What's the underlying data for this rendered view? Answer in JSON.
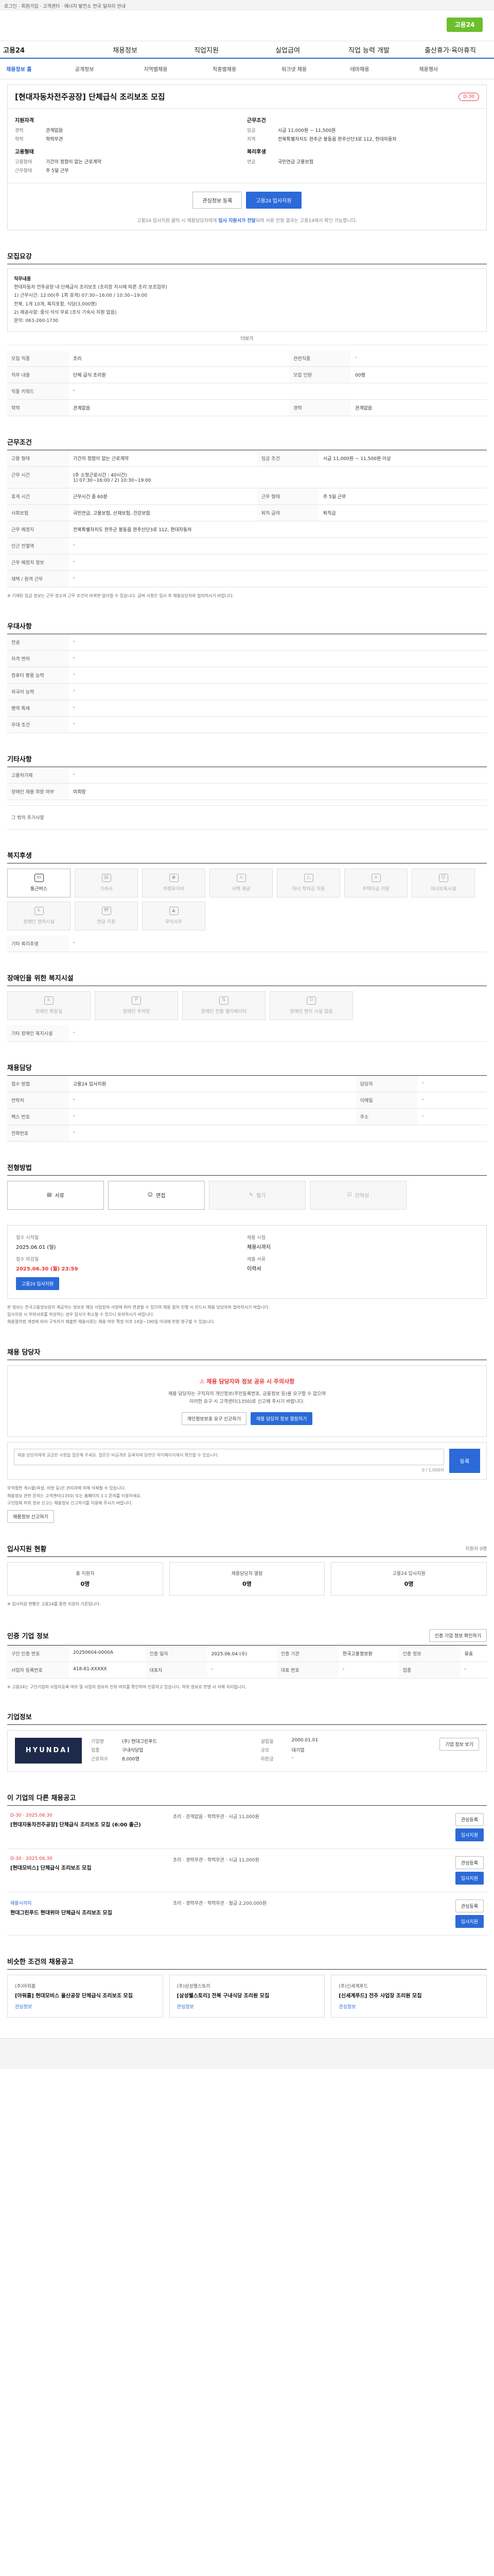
{
  "topbar": {
    "text": "로그인 · 회원가입 · 고객센터 · 에너지 발전소 전국 일자리 안내"
  },
  "header": {
    "logo": "고용24"
  },
  "gnb": [
    "고용24",
    "채용정보",
    "직업지원",
    "실업급여",
    "직업 능력 개발",
    "출산휴가·육아휴직"
  ],
  "subnav": {
    "items": [
      "채용정보 홈",
      "공개정보",
      "지역별채용",
      "직종별채용",
      "워크넷 채용",
      "테마채용",
      "채용행사"
    ],
    "active": 0
  },
  "job": {
    "title": "[현대자동차전주공장] 단체급식 조리보조 모집",
    "dday": "D-30",
    "recruiter": {
      "heading": "지원자격",
      "rows": [
        [
          "경력",
          "관계없음"
        ],
        [
          "학력",
          "학력무관"
        ]
      ]
    },
    "conditions": {
      "heading": "근무조건",
      "rows": [
        [
          "임금",
          "시급 11,000원 ~ 11,500원"
        ],
        [
          "지역",
          "전북특별자치도 완주군 봉동읍 완주산단3로 112, 현대자동차"
        ]
      ]
    },
    "employ": {
      "heading": "고용형태",
      "rows": [
        [
          "고용형태",
          "기간의 정함이 없는 근로계약"
        ],
        [
          "근무형태",
          "주 5일 근무"
        ]
      ]
    },
    "welfare": {
      "heading": "복리후생",
      "rows": [
        [
          "연금",
          "국민연금 고용보험"
        ]
      ]
    },
    "buttons": {
      "scrap": "관심정보 등록",
      "apply": "고용24 입사지원"
    },
    "notice_a": "고용24 입사지원 클릭 시 채용담당자에게 ",
    "notice_b": "입사 지원서가 전달",
    "notice_c": "되며 서류 전형 결과는 고용24에서 확인 가능합니다."
  },
  "duties": {
    "heading": "모집요강",
    "lines": [
      "직무내용",
      "현대자동차 전주공장 내 단체급식 조리보조 (조리장 지시에 따른 조리 보조업무)",
      "1) 근무시간: 12:00(주 1회 휴게) 07:30~16:00 / 10:30~19:00",
      "전북, 1개 10개, 복지포함, 식당(3,000명)",
      "2) 제공사항: 중식·석식 무료 (조식 기숙사 지원 없음)",
      "문의: 063-260-1730"
    ],
    "more": "더보기"
  },
  "recruit_table": {
    "rows": [
      [
        "모집 직종",
        "조리",
        "관련직종",
        "-"
      ],
      [
        "직무 내용",
        "단체 급식 조리원",
        "모집 인원",
        "00명"
      ],
      [
        "직종 키워드",
        "-",
        "",
        ""
      ],
      [
        "학력",
        "관계없음",
        "경력",
        "관계없음"
      ]
    ]
  },
  "work": {
    "heading": "근무조건",
    "rows": [
      [
        "고용 형태",
        "기간의 정함이 없는 근로계약",
        "임금 조건",
        "시급 11,000원 ~ 11,500원 이상"
      ],
      [
        "근무 시간",
        "(주 소정근로시간 : 40시간)\n1) 07:30~16:00 / 2) 10:30~19:00",
        "",
        ""
      ],
      [
        "휴게 시간",
        "근무시간 중 60분",
        "근무 형태",
        "주 5일 근무"
      ],
      [
        "사회보험",
        "국민연금, 고용보험, 산재보험, 건강보험",
        "퇴직 급여",
        "퇴직금"
      ],
      [
        "근무 예정지",
        "전북특별자치도 완주군 봉동읍 완주산단3로 112, 현대자동차",
        "",
        ""
      ],
      [
        "인근 전철역",
        "-",
        "",
        ""
      ],
      [
        "근무 예정지 정보",
        "-",
        "",
        ""
      ],
      [
        "재택 / 원격 근무",
        "-",
        "",
        ""
      ]
    ],
    "note": "※ 기재된 임금 정보는 근무 장소의 근무 조건이 바뀌면 달라질 수 있습니다. 급여 사항은 입사 후 채용담당자와 협의하시기 바랍니다."
  },
  "prefs": {
    "heading": "우대사항",
    "rows": [
      [
        "전공",
        "-"
      ],
      [
        "자격 면허",
        "-"
      ],
      [
        "컴퓨터 활용 능력",
        "-"
      ],
      [
        "외국어 능력",
        "-"
      ],
      [
        "병역 특례",
        "-"
      ],
      [
        "우대 조건",
        "-"
      ]
    ]
  },
  "other": {
    "heading": "기타사항",
    "rows": [
      [
        "고용허가제",
        "-"
      ],
      [
        "장애인 채용 희망 여부",
        "미희망"
      ]
    ],
    "etc_label": "그 밖의 추가사항"
  },
  "benefits": {
    "heading": "복지후생",
    "items": [
      "통근버스",
      "기숙사",
      "차량유지비",
      "사택 제공",
      "자녀 학자금 지원",
      "주택자금 지원",
      "자녀보육시설",
      "장애인 편의시설",
      "연금 지원",
      "우리사주"
    ],
    "active": [
      0
    ],
    "etc_label": "기타 복리후생",
    "etc_value": "-"
  },
  "disability": {
    "heading": "장애인을 위한 복지시설",
    "items": [
      "장애인 화장실",
      "장애인 주차장",
      "장애인 전용 엘리베이터",
      "장애인 편의 시설 없음"
    ],
    "etc_label": "기타 장애인 복지시설",
    "etc_value": "-"
  },
  "contact": {
    "heading": "채용담당",
    "rows": [
      [
        "접수 방법",
        "고용24 입사지원",
        "담당자",
        "-"
      ],
      [
        "연락처",
        "-",
        "이메일",
        "-"
      ],
      [
        "팩스 번호",
        "-",
        "주소",
        "-"
      ],
      [
        "전화번호",
        "-",
        "",
        ""
      ]
    ]
  },
  "process": {
    "heading": "전형방법",
    "items": [
      "서류",
      "면접",
      "필기",
      "인적성"
    ],
    "active": [
      0,
      1
    ]
  },
  "schedule": {
    "start_label": "접수 시작일",
    "start": "2025.06.01 (일)",
    "end_label": "접수 마감일",
    "end": "2025.06.30 (월) 23:59",
    "status_label": "채용 시점",
    "status": "채용시까지",
    "doc_label": "제출 서류",
    "doc": "이력서",
    "apply_btn": "고용24 입사지원",
    "bullets": [
      "본 정보는 한국고용정보원이 제공하는 정보로 해당 사업장의 사정에 따라 변경될 수 있으며 채용 절차 진행 시 반드시 채용 담당자와 협의하시기 바랍니다.",
      "입사지원 시 허위서류를 작성하는 경우 입사가 취소될 수 있으니 유의하시기 바랍니다.",
      "채용절차법 개정에 따라 구직자가 제출한 채용서류는 채용 여부 확정 이후 14일~180일 이내에 반환 청구할 수 있습니다."
    ]
  },
  "report": {
    "heading": "채용 담당자",
    "title": "채용 담당자와 정보 공유 시 주의사항",
    "desc1": "채용 담당자는 구직자의 개인정보(주민등록번호, 금융정보 등)를 요구할 수 없으며",
    "desc2": "이러한 요구 시 고객센터(1350)로 신고해 주시기 바랍니다.",
    "btn1": "개인정보보호 요구 신고하기",
    "btn2": "채용 담당자 정보 열람하기"
  },
  "qa": {
    "placeholder": "채용 담당자에게 궁금한 사항을 질문해 주세요. 질문은 비공개로 등록되며 답변은 마이페이지에서 확인할 수 있습니다.",
    "count": "0 / 1,000자",
    "submit": "등록",
    "bullets": [
      "부적절한 게시물(욕설, 비방 등)은 관리자에 의해 삭제될 수 있습니다.",
      "채용정보 관련 문의는 고객센터(1350) 또는 홈페이지 1:1 문의를 이용하세요.",
      "구인업체 허위 정보 신고는 채용정보 신고하기를 이용해 주시기 바랍니다."
    ],
    "report_btn": "채용정보 신고하기"
  },
  "stats": {
    "heading": "입사지원 현황",
    "right": "지원자 0명",
    "items": [
      [
        "총 지원자",
        "0명"
      ],
      [
        "채용담당자 열람",
        "0명"
      ],
      [
        "고용24 입사지원",
        "0명"
      ]
    ],
    "note": "※ 입사지원 현황은 고용24를 통한 지원자 기준입니다."
  },
  "reg": {
    "heading": "인증 기업 정보",
    "right": "인증 기업 정보 확인하기",
    "rows": [
      [
        "구인 인증 번호",
        "20250604-0000A",
        "인증 일자",
        "2025.06.04 (수)",
        "인증 기관",
        "한국고용정보원",
        "인증 정보",
        "유효"
      ],
      [
        "사업자 등록번호",
        "418-81-XXXXX",
        "대표자",
        "-",
        "대표 번호",
        "-",
        "업종",
        "-"
      ]
    ],
    "note": "※ 고용24는 구인기업의 사업자등록 여부 및 사업자 정보의 진위 여부를 확인하여 인증하고 있습니다. 허위 정보로 판명 시 삭제 처리됩니다."
  },
  "company": {
    "heading": "기업정보",
    "logo": "HYUNDAI",
    "rows": [
      [
        "기업명",
        "(주) 현대그린푸드"
      ],
      [
        "설립일",
        "2000.01.01"
      ],
      [
        "업종",
        "구내식당업"
      ],
      [
        "규모",
        "대기업"
      ],
      [
        "근로자수",
        "8,000명"
      ],
      [
        "자본금",
        "-"
      ]
    ],
    "btn": "기업 정보 보기"
  },
  "jobs": {
    "heading": "이 기업의 다른 채용공고",
    "items": [
      {
        "dday": "D-30 · 2025.06.30",
        "title": "[현대자동차전주공장] 단체급식 조리보조 모집 (6:00 출근)",
        "meta": "조리 · 관계없음 · 학력무관 · 시급 11,000원",
        "btns": [
          "관심등록",
          "입사지원"
        ]
      },
      {
        "dday": "D-30 · 2025.06.30",
        "title": "[현대모비스] 단체급식 조리보조 모집",
        "meta": "조리 · 경력무관 · 학력무관 · 시급 11,000원",
        "btns": [
          "관심등록",
          "입사지원"
        ]
      },
      {
        "dday": "채용시까지",
        "title": "현대그린푸드 현대위아 단체급식 조리보조 모집",
        "meta": "조리 · 경력무관 · 학력무관 · 월급 2,200,000원",
        "btns": [
          "관심등록",
          "입사지원"
        ]
      }
    ]
  },
  "related": {
    "heading": "비슷한 조건의 채용공고",
    "items": [
      {
        "co": "(주)아워홈",
        "title": "[아워홈] 현대모비스 울산공장 단체급식 조리보조 모집",
        "ft": "관심정보"
      },
      {
        "co": "(주)삼성웰스토리",
        "title": "[삼성웰스토리] 전북 구내식당 조리원 모집",
        "ft": "관심정보"
      },
      {
        "co": "(주)신세계푸드",
        "title": "[신세계푸드] 전주 사업장 조리원 모집",
        "ft": "관심정보"
      }
    ]
  }
}
